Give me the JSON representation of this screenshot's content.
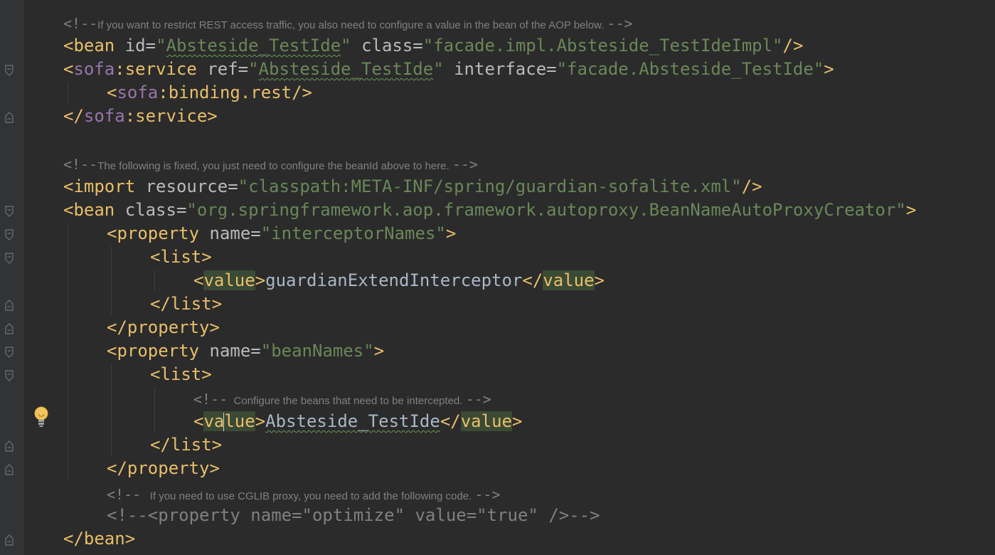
{
  "comments": {
    "rest_note": "If you want to restrict REST access traffic, you also need to configure a value in the bean of the AOP below.",
    "fixed_note": "The following is fixed, you just need to configure the beanId above to here.",
    "intercept_note": "Configure the beans that need to be intercepted.",
    "cglib_note": "If you need to use CGLIB proxy, you need to add the following code."
  },
  "code": {
    "bean1_id": "Absteside_TestIde",
    "bean1_class": "facade.impl.Absteside_TestIdeImpl",
    "service_ref": "Absteside_TestIde",
    "service_interface": "facade.Absteside_TestIde",
    "import_resource": "classpath:META-INF/spring/guardian-sofalite.xml",
    "bean2_class": "org.springframework.aop.framework.autoproxy.BeanNameAutoProxyCreator",
    "prop1_name": "interceptorNames",
    "prop1_value": "guardianExtendInterceptor",
    "prop2_name": "beanNames",
    "prop2_value": "Absteside_TestIde",
    "commented_code": "<!--<property name=\"optimize\" value=\"true\" />-->"
  },
  "icons": {
    "fold": "fold-marker-icon",
    "bulb": "intention-bulb-icon"
  },
  "colors": {
    "background": "#2b2b2b",
    "tag": "#e8bf6a",
    "string": "#6a8759",
    "comment": "#808080",
    "namespace": "#9876aa"
  }
}
